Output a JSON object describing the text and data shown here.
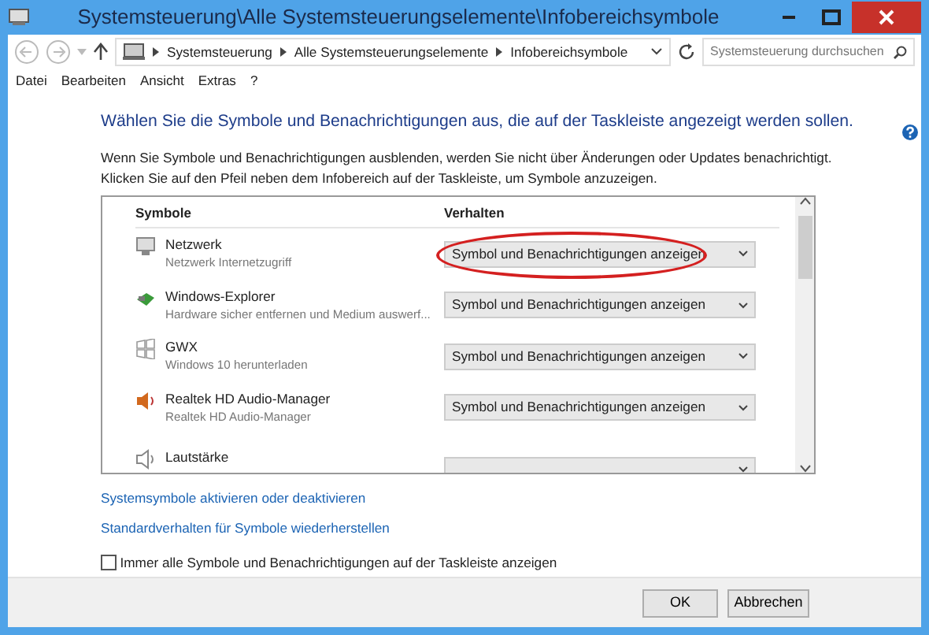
{
  "window": {
    "title": "Systemsteuerung\\Alle Systemsteuerungselemente\\Infobereichsymbole"
  },
  "address_bar": {
    "crumbs": [
      "Systemsteuerung",
      "Alle Systemsteuerungselemente",
      "Infobereichsymbole"
    ],
    "search_placeholder": "Systemsteuerung durchsuchen"
  },
  "menu": [
    "Datei",
    "Bearbeiten",
    "Ansicht",
    "Extras",
    "?"
  ],
  "heading": "Wählen Sie die Symbole und Benachrichtigungen aus, die auf der Taskleiste angezeigt werden sollen.",
  "description": "Wenn Sie Symbole und Benachrichtigungen ausblenden, werden Sie nicht über Änderungen oder Updates benachrichtigt. Klicken Sie auf den Pfeil neben dem Infobereich auf der Taskleiste, um Symbole anzuzeigen.",
  "table": {
    "columns": [
      "Symbole",
      "Verhalten"
    ],
    "rows": [
      {
        "kind": "network",
        "name": "Netzwerk",
        "detail": "Netzwerk Internetzugriff",
        "behavior": "Symbol und Benachrichtigungen anzeigen",
        "highlighted": true
      },
      {
        "kind": "explorer",
        "name": "Windows-Explorer",
        "detail": "Hardware sicher entfernen und Medium auswerf...",
        "behavior": "Symbol und Benachrichtigungen anzeigen",
        "highlighted": false
      },
      {
        "kind": "windows",
        "name": "GWX",
        "detail": "Windows 10 herunterladen",
        "behavior": "Symbol und Benachrichtigungen anzeigen",
        "highlighted": false
      },
      {
        "kind": "audio",
        "name": "Realtek HD Audio-Manager",
        "detail": "Realtek HD Audio-Manager",
        "behavior": "Symbol und Benachrichtigungen anzeigen",
        "highlighted": false
      },
      {
        "kind": "volume",
        "name": "Lautstärke",
        "highlighted": false
      }
    ]
  },
  "links": [
    "Systemsymbole aktivieren oder deaktivieren",
    "Standardverhalten für Symbole wiederherstellen"
  ],
  "always_show": {
    "label": "Immer alle Symbole und Benachrichtigungen auf der Taskleiste anzeigen",
    "checked": false
  },
  "buttons": [
    "OK",
    "Abbrechen"
  ]
}
